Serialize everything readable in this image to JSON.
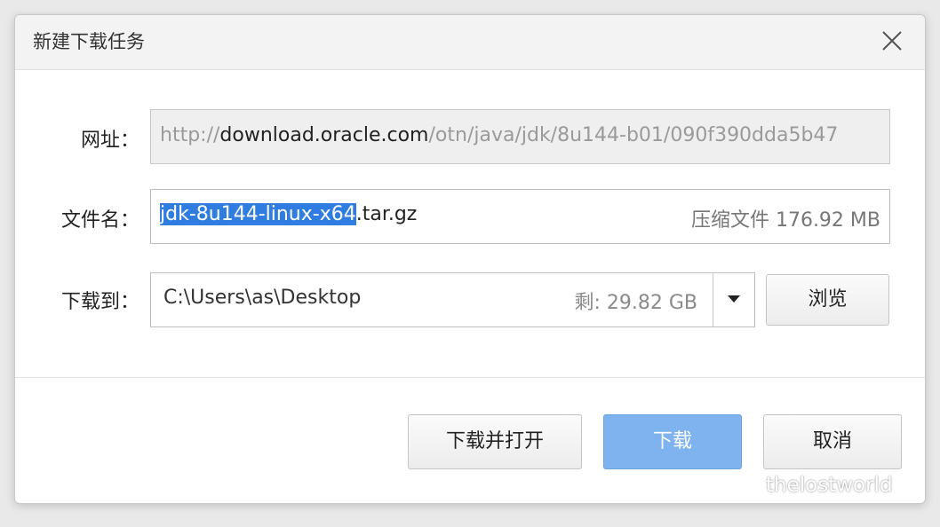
{
  "dialog": {
    "title": "新建下载任务"
  },
  "url": {
    "label": "网址：",
    "prefix": "http://",
    "host": "download.oracle.com",
    "path": "/otn/java/jdk/8u144-b01/090f390dda5b47"
  },
  "filename": {
    "label": "文件名：",
    "selected": "jdk-8u144-linux-x64",
    "rest": ".tar.gz",
    "meta": "压缩文件 176.92 MB"
  },
  "save_to": {
    "label": "下载到：",
    "path": "C:\\Users\\as\\Desktop",
    "free": "剩: 29.82 GB",
    "browse_label": "浏览"
  },
  "actions": {
    "download_open": "下载并打开",
    "download": "下载",
    "cancel": "取消"
  },
  "watermark": {
    "text": "thelostworld"
  },
  "colors": {
    "primary_button": "#7fb3ef",
    "selection": "#2f7de0"
  }
}
